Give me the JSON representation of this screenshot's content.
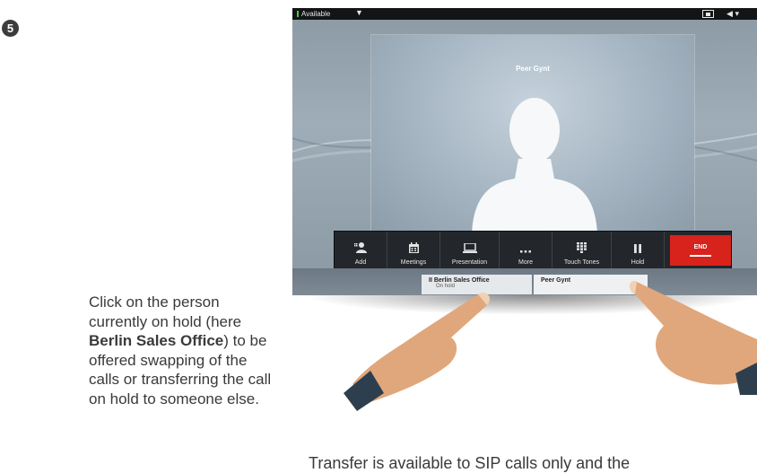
{
  "step": {
    "number": "5"
  },
  "instructions": {
    "before": "Click on the person currently on hold (here ",
    "bold": "Berlin Sales Office",
    "after": ") to be offered swapping of the calls or transferring the call on hold to someone else."
  },
  "footnote": "Transfer is available to SIP calls only and the",
  "statusbar": {
    "status_label": "Available",
    "caret": "▼",
    "volume_icon": "◀ ▾"
  },
  "call": {
    "caller_name": "Peer Gynt"
  },
  "toolbar": {
    "buttons": [
      {
        "label": "Add",
        "icon": "add-contact-icon"
      },
      {
        "label": "Meetings",
        "icon": "calendar-icon"
      },
      {
        "label": "Presentation",
        "icon": "laptop-icon"
      },
      {
        "label": "More",
        "icon": "more-dots-icon"
      },
      {
        "label": "Touch Tones",
        "icon": "keypad-icon"
      },
      {
        "label": "Hold",
        "icon": "pause-icon"
      }
    ],
    "end_label": "END",
    "end_color": "#d8221c"
  },
  "call_tabs": {
    "held": {
      "name": "Berlin Sales Office",
      "status": "On hold",
      "pause_glyph": "II"
    },
    "active": {
      "name": "Peer Gynt"
    }
  }
}
